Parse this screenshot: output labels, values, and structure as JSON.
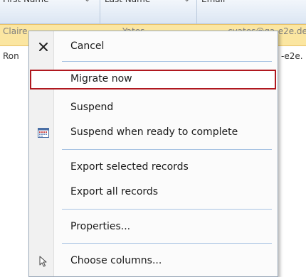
{
  "grid": {
    "headers": [
      "First Name",
      "Last Name",
      "Email"
    ],
    "rows": [
      {
        "first": "Claire",
        "last": "Yates",
        "email": "cyates@ga-e2e.de"
      },
      {
        "first": "Ron",
        "last": "",
        "email": "-e2e."
      }
    ]
  },
  "menu": {
    "items": [
      {
        "label": "Cancel",
        "icon": "close-icon"
      },
      {
        "label": "Migrate now"
      },
      {
        "label": "Suspend"
      },
      {
        "label": "Suspend when ready to complete",
        "icon": "calendar-icon"
      },
      {
        "label": "Export selected records"
      },
      {
        "label": "Export all records"
      },
      {
        "label": "Properties..."
      },
      {
        "label": "Choose columns...",
        "icon": "pointer-icon"
      }
    ]
  },
  "colors": {
    "selected_row": "#fbe6a1",
    "highlight_border": "#b0181f",
    "separator": "#a8c3e3"
  }
}
